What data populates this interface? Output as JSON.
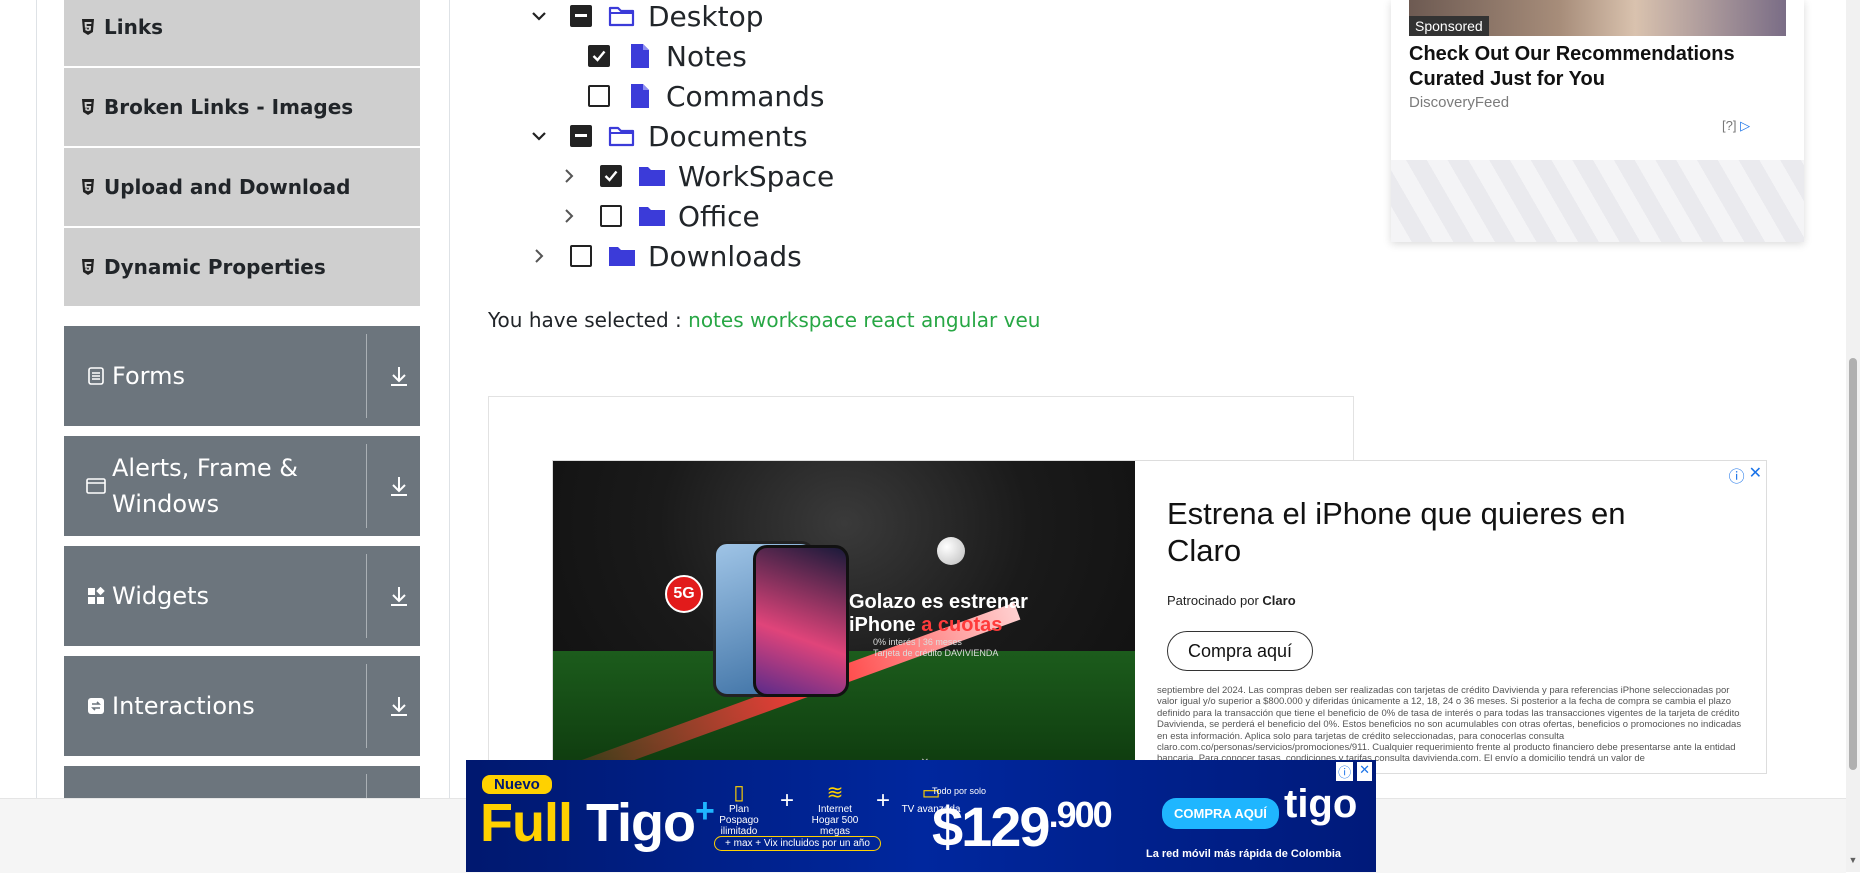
{
  "sidebar": {
    "elements_items": [
      {
        "label": "Links",
        "icon": "html5-icon"
      },
      {
        "label": "Broken Links - Images",
        "icon": "html5-icon"
      },
      {
        "label": "Upload and Download",
        "icon": "html5-icon"
      },
      {
        "label": "Dynamic Properties",
        "icon": "html5-icon"
      }
    ],
    "groups": [
      {
        "label": "Forms",
        "icon": "form-icon"
      },
      {
        "label": "Alerts, Frame & Windows",
        "icon": "window-icon"
      },
      {
        "label": "Widgets",
        "icon": "widgets-icon"
      },
      {
        "label": "Interactions",
        "icon": "interactions-icon"
      }
    ]
  },
  "tree": {
    "nodes": [
      {
        "label": "Desktop",
        "state": "partial",
        "expanded": true,
        "folder": "open"
      },
      {
        "label": "Notes",
        "state": "checked",
        "type": "file"
      },
      {
        "label": "Commands",
        "state": "unchecked",
        "type": "file"
      },
      {
        "label": "Documents",
        "state": "partial",
        "expanded": true,
        "folder": "open"
      },
      {
        "label": "WorkSpace",
        "state": "checked",
        "expanded": false,
        "folder": "closed"
      },
      {
        "label": "Office",
        "state": "unchecked",
        "expanded": false,
        "folder": "closed"
      },
      {
        "label": "Downloads",
        "state": "unchecked",
        "expanded": false,
        "folder": "closed"
      }
    ],
    "selected_label": "You have selected :",
    "selected_values": "notes workspace react angular veu"
  },
  "sponsored_card": {
    "tag": "Sponsored",
    "title": "Check Out Our Recommendations Curated Just for You",
    "source": "DiscoveryFeed",
    "help": "[?]"
  },
  "iphone_ad": {
    "badge": "5G",
    "slogan_line1": "Golazo es estrenar",
    "slogan_line2_a": "iPhone ",
    "slogan_line2_b": "a cuotas",
    "fine1": "0% interés | 36 meses",
    "fine2": "Tarjeta de crédito DAVIVIENDA",
    "headline": "Estrena el iPhone que quieres en Claro",
    "sponsored_by_prefix": "Patrocinado por ",
    "sponsored_by_brand": "Claro",
    "cta": "Compra aquí",
    "legal": "septiembre del 2024. Las compras deben ser realizadas con tarjetas de crédito Davivienda y para referencias iPhone seleccionadas por valor igual y/o superior a $800.000 y diferidas únicamente a 12, 18, 24 o 36 meses. Si posterior a la fecha de compra se cambia el plazo definido para la transacción que tiene el beneficio de 0% de tasa de interés o para todas las transacciones vigentes de la tarjeta de crédito Davivienda, se perderá el beneficio del 0%. Estos beneficios no son acumulables con otras ofertas, beneficios o promociones no indicadas en esta información. Aplica solo para tarjetas de crédito seleccionadas, para conocerlas consulta claro.com.co/personas/servicios/promociones/911. Cualquier requerimiento frente al producto financiero debe presentarse ante la entidad bancaria. Para conocer tasas, condiciones y tarifas consulta davivienda.com. El envío a domicilio tendrá un valor de"
  },
  "tigo_ad": {
    "nuevo": "Nuevo",
    "full": "Full ",
    "brand": "Tigo",
    "item1": "Plan Pospago ilimitado",
    "item2": "Internet Hogar 500 megas",
    "item3": "TV avanzada",
    "bundle": "+ max + Vix incluidos por un año",
    "todo": "Todo por solo",
    "price_main": "$129",
    "price_small": ".900",
    "cta": "COMPRA AQUÍ",
    "logo": "tigo",
    "tagline": "La red móvil más rápida de Colombia"
  },
  "colors": {
    "sidebar_item_bg": "#cfcfcf",
    "group_bg": "#6c757d",
    "folder": "#3b3bd9",
    "selected_value": "#28a745",
    "tigo_bg": "#00279e"
  }
}
